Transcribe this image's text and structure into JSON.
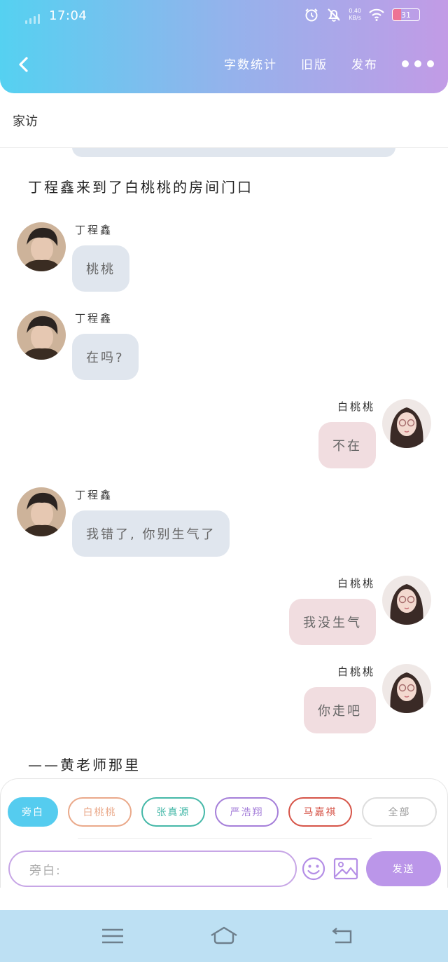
{
  "status_bar": {
    "time": "17:04",
    "speed_value": "0.40",
    "speed_unit": "KB/s",
    "battery": "31",
    "battery_level": 0.31,
    "icons": [
      "signal-icon",
      "alarm-icon",
      "bell-off-icon",
      "wifi-icon",
      "battery-icon"
    ]
  },
  "header": {
    "back_icon": "chevron-left-icon",
    "actions": [
      "字数统计",
      "旧版",
      "发布"
    ],
    "more_icon": "more-dots-icon"
  },
  "page_title": "家访",
  "chat": {
    "narrations": [
      "丁程鑫来到了白桃桃的房间门口",
      "——黄老师那里"
    ],
    "messages": [
      {
        "side": "left",
        "name": "丁程鑫",
        "text": "桃桃"
      },
      {
        "side": "left",
        "name": "丁程鑫",
        "text": "在吗?"
      },
      {
        "side": "right",
        "name": "白桃桃",
        "text": "不在"
      },
      {
        "side": "left",
        "name": "丁程鑫",
        "text": "我错了, 你别生气了"
      },
      {
        "side": "right",
        "name": "白桃桃",
        "text": "我没生气"
      },
      {
        "side": "right",
        "name": "白桃桃",
        "text": "你走吧"
      }
    ]
  },
  "composer": {
    "roles": [
      {
        "label": "旁白",
        "color": "#55ccef",
        "active": true
      },
      {
        "label": "白桃桃",
        "color": "#eaa98a",
        "active": false
      },
      {
        "label": "张真源",
        "color": "#45b8a8",
        "active": false
      },
      {
        "label": "严浩翔",
        "color": "#a57fd9",
        "active": false
      },
      {
        "label": "马嘉祺",
        "color": "#d65448",
        "active": false
      },
      {
        "label": "全部",
        "color": "#cccccc",
        "active": false
      }
    ],
    "input_placeholder": "旁白:",
    "emoji_icon": "emoji-icon",
    "image_icon": "image-icon",
    "send_label": "发送"
  },
  "system_nav": {
    "icons": [
      "menu-icon",
      "home-icon",
      "back-icon"
    ]
  },
  "colors": {
    "header_gradient": [
      "#55d1f1",
      "#93b3ec",
      "#c29be6"
    ],
    "bubble_left": "#e0e6ee",
    "bubble_right": "#f1dde0",
    "send_button": "#bb96e9",
    "system_nav": "#bde0f3"
  }
}
